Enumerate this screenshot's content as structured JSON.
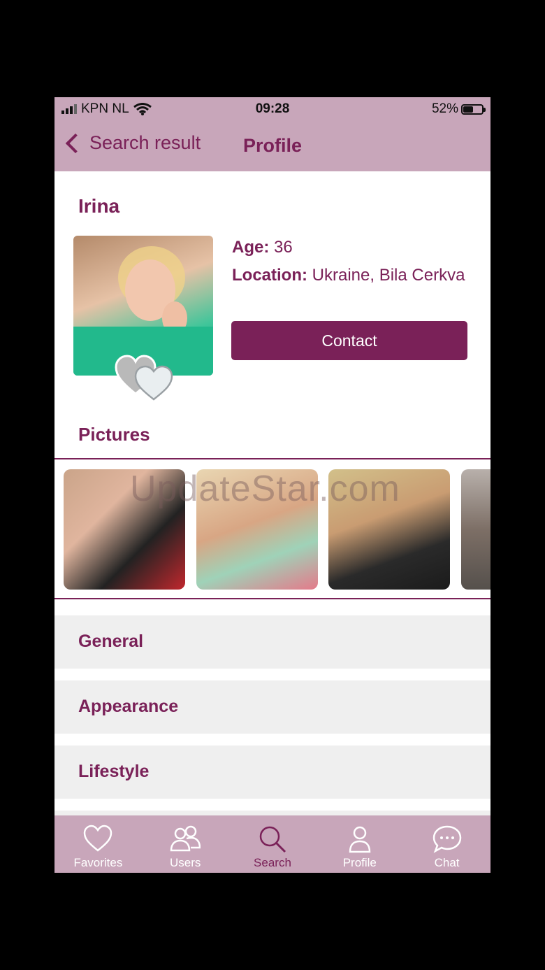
{
  "status": {
    "carrier": "KPN NL",
    "time": "09:28",
    "battery": "52%",
    "battery_level": 0.52
  },
  "nav": {
    "back_label": "Search result",
    "title": "Profile"
  },
  "profile": {
    "name": "Irina",
    "age_label": "Age:",
    "age": "36",
    "location_label": "Location:",
    "location": "Ukraine, Bila Cerkva",
    "contact_label": "Contact"
  },
  "pictures": {
    "title": "Pictures",
    "watermark": "UpdateStar.com"
  },
  "sections": [
    "General",
    "Appearance",
    "Lifestyle"
  ],
  "tabs": [
    {
      "label": "Favorites",
      "icon": "heart-icon",
      "active": false
    },
    {
      "label": "Users",
      "icon": "users-icon",
      "active": false
    },
    {
      "label": "Search",
      "icon": "search-icon",
      "active": true
    },
    {
      "label": "Profile",
      "icon": "person-icon",
      "active": false
    },
    {
      "label": "Chat",
      "icon": "chat-bubble-icon",
      "active": false
    }
  ],
  "colors": {
    "accent": "#7a2158",
    "bar": "#c8a6ba",
    "section_bg": "#efefef"
  }
}
